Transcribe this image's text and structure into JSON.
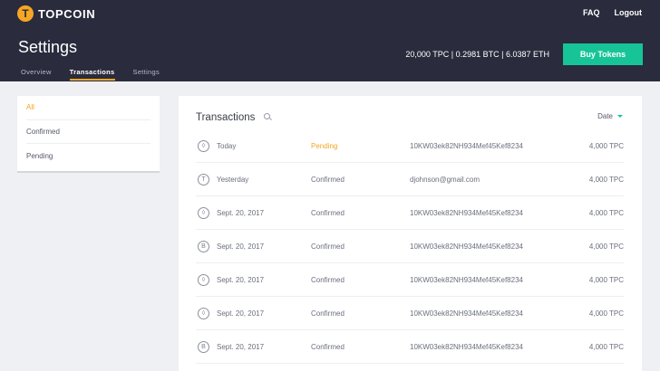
{
  "brand": {
    "name": "TOPCOIN",
    "mark": "T"
  },
  "nav": {
    "faq": "FAQ",
    "logout": "Logout"
  },
  "header": {
    "title": "Settings",
    "balances": "20,000 TPC | 0.2981 BTC | 6.0387 ETH",
    "buy_label": "Buy Tokens",
    "tabs": [
      {
        "label": "Overview",
        "active": false
      },
      {
        "label": "Transactions",
        "active": true
      },
      {
        "label": "Settings",
        "active": false
      }
    ]
  },
  "filters": [
    {
      "label": "All",
      "active": true
    },
    {
      "label": "Confirmed",
      "active": false
    },
    {
      "label": "Pending",
      "active": false
    }
  ],
  "panel": {
    "title": "Transactions",
    "sort_label": "Date"
  },
  "colors": {
    "accent": "#f5a623",
    "primary": "#17c497",
    "header_bg": "#2a2b3d"
  },
  "transactions": [
    {
      "icon": "ethereum-icon",
      "glyph": "◊",
      "date": "Today",
      "status": "Pending",
      "address": "10KW03ek82NH934Mef45Kef8234",
      "amount": "4,000 TPC"
    },
    {
      "icon": "topcoin-icon",
      "glyph": "T",
      "date": "Yesterday",
      "status": "Confirmed",
      "address": "djohnson@gmail.com",
      "amount": "4,000 TPC"
    },
    {
      "icon": "ethereum-icon",
      "glyph": "◊",
      "date": "Sept. 20, 2017",
      "status": "Confirmed",
      "address": "10KW03ek82NH934Mef45Kef8234",
      "amount": "4,000 TPC"
    },
    {
      "icon": "bitcoin-icon",
      "glyph": "B",
      "date": "Sept. 20, 2017",
      "status": "Confirmed",
      "address": "10KW03ek82NH934Mef45Kef8234",
      "amount": "4,000 TPC"
    },
    {
      "icon": "ethereum-icon",
      "glyph": "◊",
      "date": "Sept. 20, 2017",
      "status": "Confirmed",
      "address": "10KW03ek82NH934Mef45Kef8234",
      "amount": "4,000 TPC"
    },
    {
      "icon": "ethereum-icon",
      "glyph": "◊",
      "date": "Sept. 20, 2017",
      "status": "Confirmed",
      "address": "10KW03ek82NH934Mef45Kef8234",
      "amount": "4,000 TPC"
    },
    {
      "icon": "bitcoin-icon",
      "glyph": "B",
      "date": "Sept. 20, 2017",
      "status": "Confirmed",
      "address": "10KW03ek82NH934Mef45Kef8234",
      "amount": "4,000 TPC"
    }
  ]
}
